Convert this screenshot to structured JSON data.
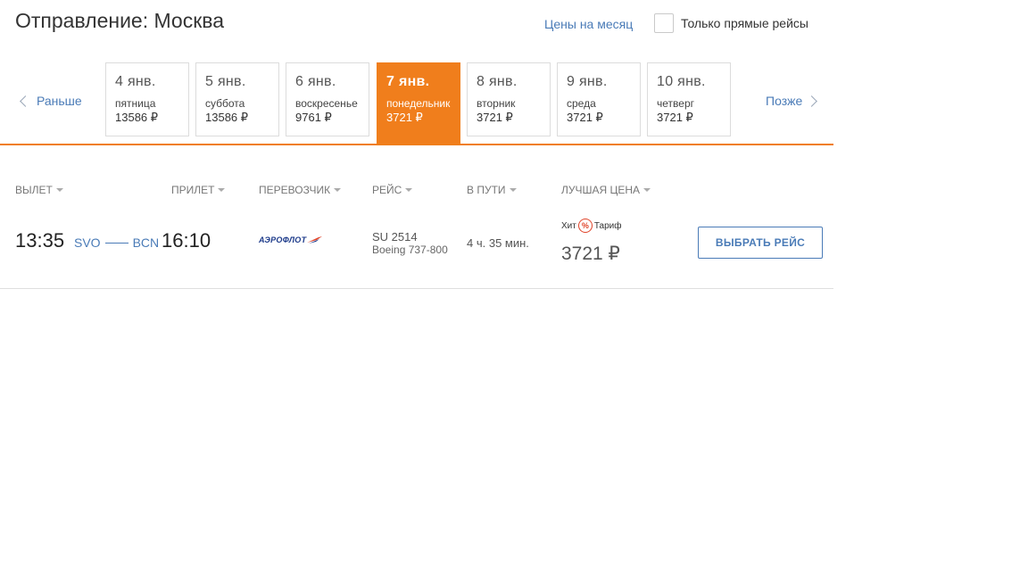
{
  "header": {
    "title": "Отправление: Москва",
    "month_prices_link": "Цены на месяц",
    "direct_only_label": "Только прямые рейсы",
    "direct_only_checked": false
  },
  "date_strip": {
    "earlier_label": "Раньше",
    "later_label": "Позже",
    "accent_color": "#f07e1c",
    "dates": [
      {
        "date": "4 янв.",
        "day": "пятница",
        "price": "13586 ₽",
        "selected": false
      },
      {
        "date": "5 янв.",
        "day": "суббота",
        "price": "13586 ₽",
        "selected": false
      },
      {
        "date": "6 янв.",
        "day": "воскресенье",
        "price": "9761 ₽",
        "selected": false
      },
      {
        "date": "7 янв.",
        "day": "понедельник",
        "price": "3721 ₽",
        "selected": true
      },
      {
        "date": "8 янв.",
        "day": "вторник",
        "price": "3721 ₽",
        "selected": false
      },
      {
        "date": "9 янв.",
        "day": "среда",
        "price": "3721 ₽",
        "selected": false
      },
      {
        "date": "10 янв.",
        "day": "четверг",
        "price": "3721 ₽",
        "selected": false
      }
    ]
  },
  "columns": {
    "departure": "ВЫЛЕТ",
    "arrival": "ПРИЛЕТ",
    "carrier": "ПЕРЕВОЗЧИК",
    "flight": "РЕЙС",
    "duration": "В ПУТИ",
    "best_price": "ЛУЧШАЯ ЦЕНА"
  },
  "flight": {
    "departure_time": "13:35",
    "origin": "SVO",
    "destination": "BCN",
    "arrival_time": "16:10",
    "carrier_logo_text": "АЭРОФЛОТ",
    "flight_number": "SU 2514",
    "aircraft": "Boeing 737-800",
    "duration": "4 ч. 35 мин.",
    "tariff_left": "Хит",
    "tariff_pct": "%",
    "tariff_right": "Тариф",
    "price": "3721 ₽",
    "select_button": "ВЫБРАТЬ РЕЙС"
  }
}
